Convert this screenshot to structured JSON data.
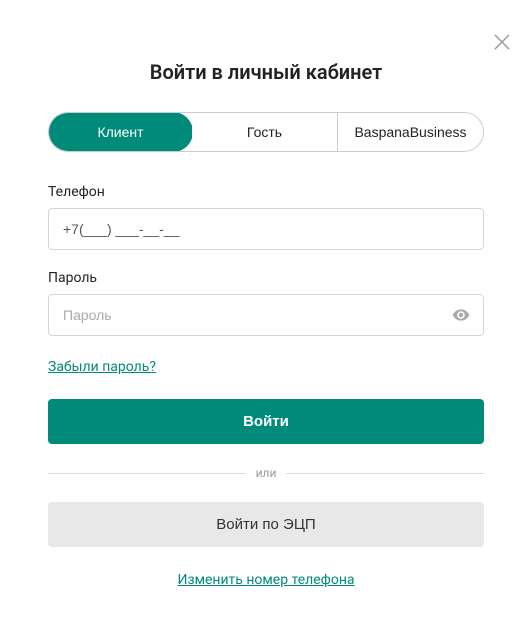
{
  "title": "Войти в личный кабинет",
  "tabs": [
    {
      "label": "Клиент",
      "active": true
    },
    {
      "label": "Гость",
      "active": false
    },
    {
      "label": "BaspanaBusiness",
      "active": false
    }
  ],
  "phone": {
    "label": "Телефон",
    "value": "+7(___) ___-__-__"
  },
  "password": {
    "label": "Пароль",
    "placeholder": "Пароль"
  },
  "forgot_password": "Забыли пароль?",
  "login_button": "Войти",
  "divider": "или",
  "eds_button": "Войти по ЭЦП",
  "change_phone": "Изменить номер телефона"
}
